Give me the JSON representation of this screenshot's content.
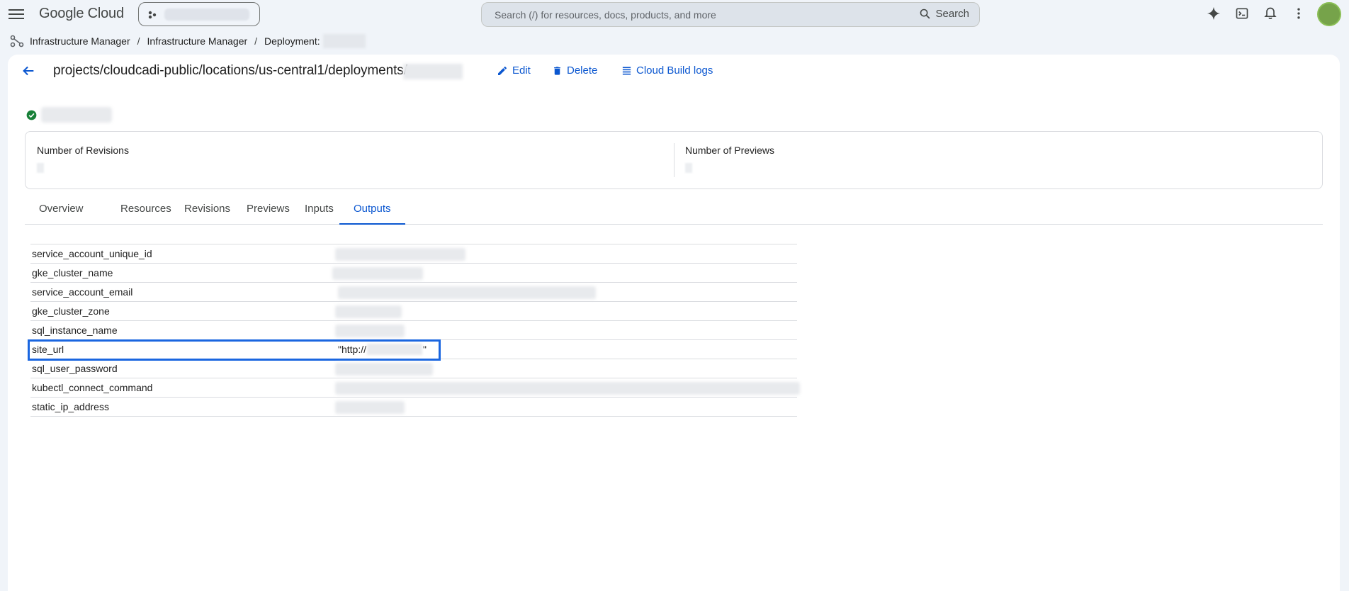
{
  "topbar": {
    "logo": "Google Cloud",
    "search_placeholder": "Search (/) for resources, docs, products, and more",
    "search_button": "Search",
    "icons": [
      "menu-icon",
      "project-icon",
      "search-icon",
      "gemini-icon",
      "cloud-shell-icon",
      "notifications-icon",
      "more-vert-icon"
    ]
  },
  "breadcrumb": {
    "items": [
      "Infrastructure Manager",
      "Infrastructure Manager",
      "Deployment:"
    ]
  },
  "header": {
    "path": "projects/cloudcadi-public/locations/us-central1/deployments/",
    "actions": {
      "edit": "Edit",
      "delete": "Delete",
      "logs": "Cloud Build logs"
    }
  },
  "metrics": {
    "revisions_label": "Number of Revisions",
    "previews_label": "Number of Previews"
  },
  "tabs": [
    "Overview",
    "Resources",
    "Revisions",
    "Previews",
    "Inputs",
    "Outputs"
  ],
  "active_tab": "Outputs",
  "outputs": {
    "rows": [
      {
        "key": "service_account_unique_id"
      },
      {
        "key": "gke_cluster_name"
      },
      {
        "key": "service_account_email"
      },
      {
        "key": "gke_cluster_zone"
      },
      {
        "key": "sql_instance_name"
      },
      {
        "key": "site_url",
        "value_prefix": "\"http://",
        "value_suffix": "\""
      },
      {
        "key": "sql_user_password"
      },
      {
        "key": "kubectl_connect_command"
      },
      {
        "key": "static_ip_address"
      }
    ]
  },
  "colors": {
    "accent": "#0b57d0",
    "highlight": "#1a66e0",
    "status_ok": "#188038"
  }
}
